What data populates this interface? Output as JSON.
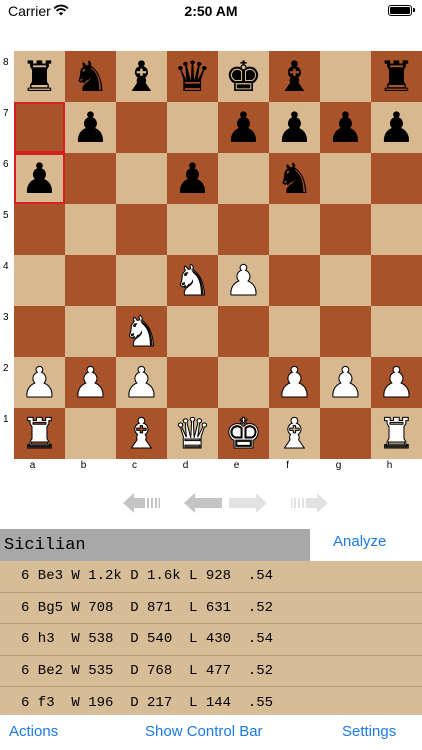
{
  "status": {
    "carrier": "Carrier",
    "time": "2:50 AM"
  },
  "board": {
    "ranks": [
      "8",
      "7",
      "6",
      "5",
      "4",
      "3",
      "2",
      "1"
    ],
    "files": [
      "a",
      "b",
      "c",
      "d",
      "e",
      "f",
      "g",
      "h"
    ],
    "highlight": [
      "a7",
      "a6"
    ],
    "light_color": "#d8b98f",
    "dark_color": "#a9532b",
    "pieces": {
      "a8": "bR",
      "b8": "bN",
      "c8": "bB",
      "d8": "bQ",
      "e8": "bK",
      "f8": "bB",
      "h8": "bR",
      "b7": "bP",
      "e7": "bP",
      "f7": "bP",
      "g7": "bP",
      "h7": "bP",
      "a6": "bP",
      "d6": "bP",
      "f6": "bN",
      "d4": "wN",
      "e4": "wP",
      "c3": "wN",
      "a2": "wP",
      "b2": "wP",
      "c2": "wP",
      "f2": "wP",
      "g2": "wP",
      "h2": "wP",
      "a1": "wR",
      "c1": "wB",
      "d1": "wQ",
      "e1": "wK",
      "f1": "wB",
      "h1": "wR"
    }
  },
  "opening": {
    "name": "Sicilian",
    "analyze_label": "Analyze"
  },
  "moves": [
    {
      "num": "6",
      "move": "Be3",
      "w": "1.2k",
      "d": "1.6k",
      "l": "928",
      "score": ".54"
    },
    {
      "num": "6",
      "move": "Bg5",
      "w": "708",
      "d": "871",
      "l": "631",
      "score": ".52"
    },
    {
      "num": "6",
      "move": "h3",
      "w": "538",
      "d": "540",
      "l": "430",
      "score": ".54"
    },
    {
      "num": "6",
      "move": "Be2",
      "w": "535",
      "d": "768",
      "l": "477",
      "score": ".52"
    },
    {
      "num": "6",
      "move": "f3",
      "w": "196",
      "d": "217",
      "l": "144",
      "score": ".55"
    }
  ],
  "toolbar": {
    "actions": "Actions",
    "show_control_bar": "Show Control Bar",
    "settings": "Settings"
  },
  "colors": {
    "accent": "#1a7ae6",
    "highlight": "#d42020",
    "moves_bg": "#d6bc97"
  }
}
